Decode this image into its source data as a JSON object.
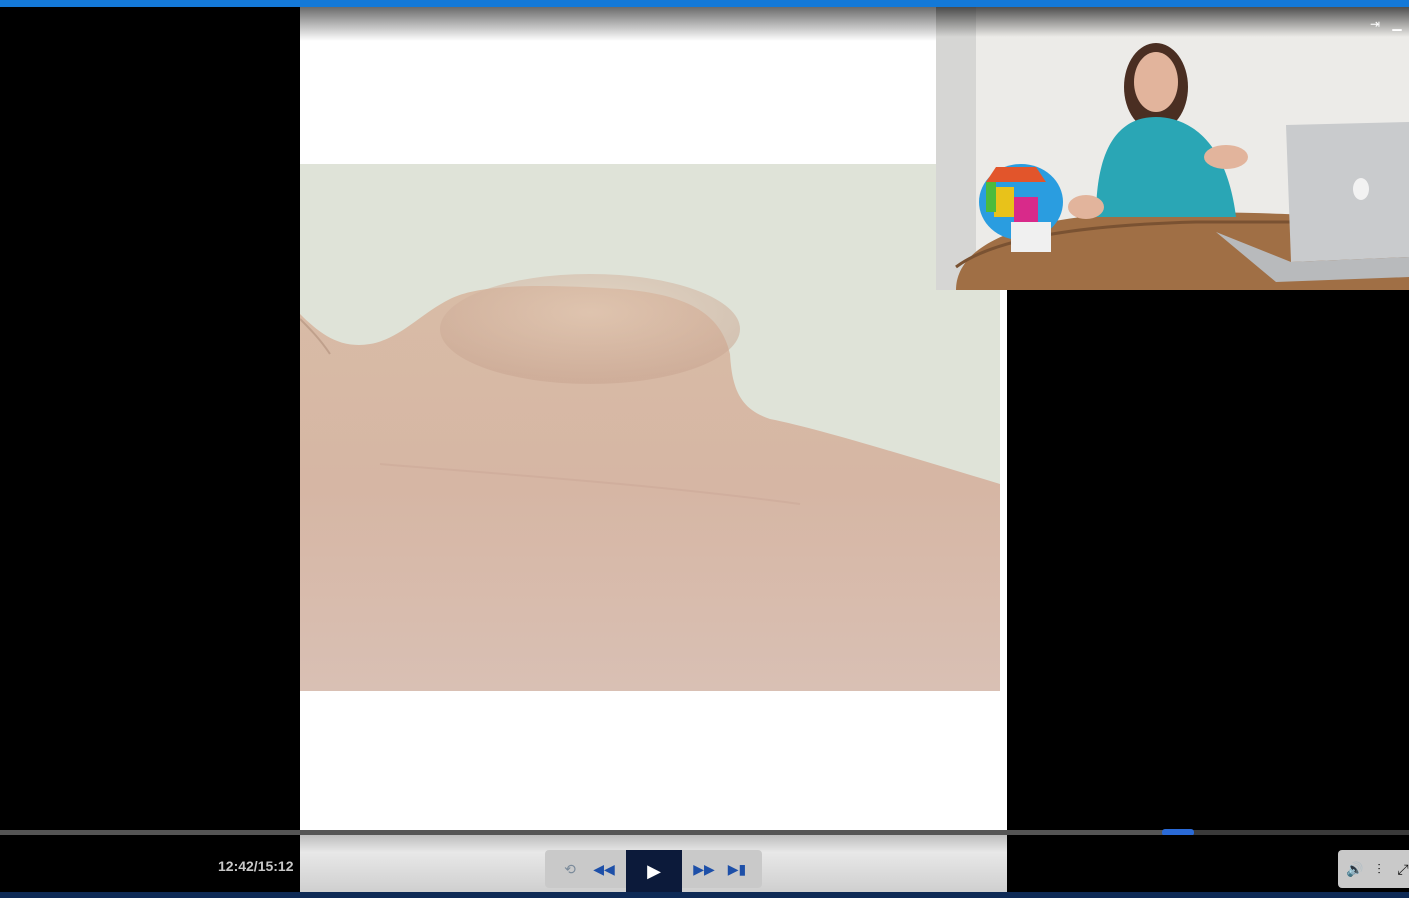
{
  "player": {
    "time_display": "12:42/15:12",
    "progress": 0.836,
    "accent_color": "#1479d8",
    "thumb_color": "#2a6ad6"
  },
  "pip": {
    "unpin_icon": "pin-icon",
    "minimize_icon": "minimize-icon"
  },
  "transport": {
    "loop_icon": "loop-icon",
    "rewind_icon": "rewind-icon",
    "play_icon": "play-icon",
    "fast_forward_icon": "fast-forward-icon",
    "skip_end_icon": "skip-end-icon"
  },
  "right_controls": {
    "volume_icon": "volume-icon",
    "settings_icon": "settings-sliders-icon",
    "fullscreen_icon": "fullscreen-icon"
  }
}
